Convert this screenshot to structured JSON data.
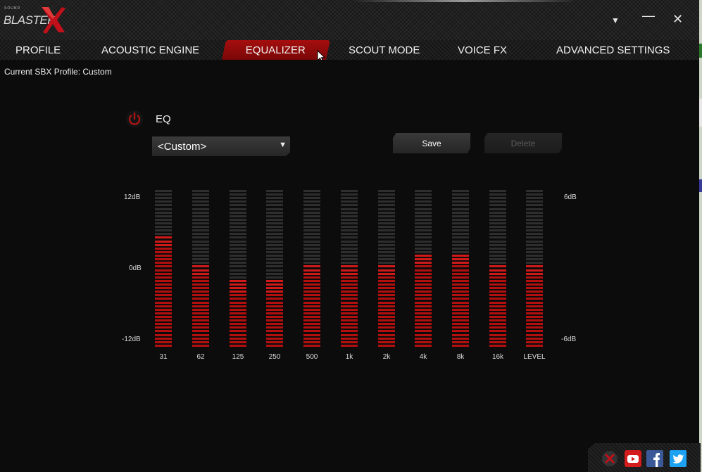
{
  "app": {
    "logo_small_word": "SOUND",
    "logo_brand": "BLASTER",
    "logo_mark": "X",
    "accent_color": "#b30f0f"
  },
  "window_controls": {
    "dropdown_icon": "▼",
    "minimize_icon": "—",
    "close_icon": "✕"
  },
  "tabs": [
    {
      "label": "PROFILE",
      "active": false
    },
    {
      "label": "ACOUSTIC ENGINE",
      "active": false
    },
    {
      "label": "EQUALIZER",
      "active": true
    },
    {
      "label": "SCOUT MODE",
      "active": false
    },
    {
      "label": "VOICE FX",
      "active": false
    },
    {
      "label": "ADVANCED SETTINGS",
      "active": false
    }
  ],
  "profile": {
    "label": "Current SBX Profile: Custom"
  },
  "eq": {
    "title": "EQ",
    "enabled": true,
    "preset_value": "<Custom>",
    "save_label": "Save",
    "delete_label": "Delete",
    "delete_enabled": false,
    "left_axis": {
      "top": "12dB",
      "mid": "0dB",
      "bottom": "-12dB"
    },
    "right_axis": {
      "top": "6dB",
      "bottom": "-6dB"
    },
    "bands": [
      {
        "label": "31",
        "gain_db": 5.5
      },
      {
        "label": "62",
        "gain_db": 0.5
      },
      {
        "label": "125",
        "gain_db": -2.0
      },
      {
        "label": "250",
        "gain_db": -2.0
      },
      {
        "label": "500",
        "gain_db": 0.5
      },
      {
        "label": "1k",
        "gain_db": 0.5
      },
      {
        "label": "2k",
        "gain_db": 0.5
      },
      {
        "label": "4k",
        "gain_db": 2.5
      },
      {
        "label": "8k",
        "gain_db": 2.5
      },
      {
        "label": "16k",
        "gain_db": 0.5
      }
    ],
    "level": {
      "label": "LEVEL",
      "gain_db": 0.5
    }
  },
  "footer": {
    "icons": [
      "sound-blaster-x-icon",
      "youtube-icon",
      "facebook-icon",
      "twitter-icon"
    ]
  }
}
